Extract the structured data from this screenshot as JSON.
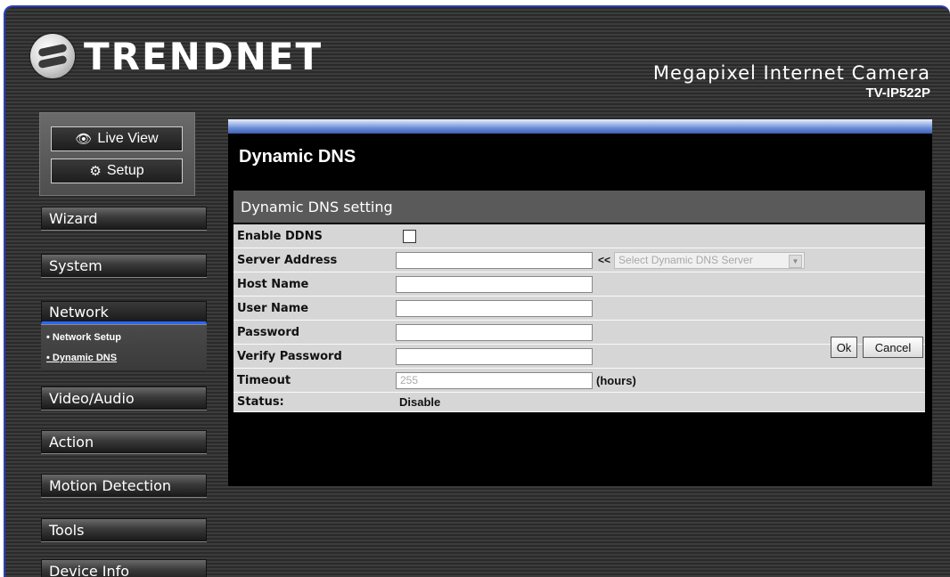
{
  "brand": {
    "logo_text": "TRENDNET",
    "product_name": "Megapixel Internet Camera",
    "model": "TV-IP522P"
  },
  "view_buttons": {
    "live_view": "Live View",
    "setup": "Setup"
  },
  "nav": {
    "wizard": "Wizard",
    "system": "System",
    "network": "Network",
    "network_sub": [
      "Network Setup",
      "Dynamic DNS"
    ],
    "video_audio": "Video/Audio",
    "action": "Action",
    "motion_detection": "Motion Detection",
    "tools": "Tools",
    "device_info": "Device Info"
  },
  "page": {
    "title": "Dynamic DNS",
    "section": "Dynamic DNS setting"
  },
  "form": {
    "enable_ddns_label": "Enable DDNS",
    "enable_ddns_checked": false,
    "server_address_label": "Server Address",
    "server_address_value": "",
    "server_select_arrows": "<<",
    "server_select_value": "Select Dynamic DNS Server",
    "host_name_label": "Host Name",
    "user_name_label": "User Name",
    "password_label": "Password",
    "verify_password_label": "Verify Password",
    "timeout_label": "Timeout",
    "timeout_value": "255",
    "timeout_unit": "(hours)",
    "status_label": "Status:",
    "status_value": "Disable"
  },
  "buttons": {
    "ok": "Ok",
    "cancel": "Cancel"
  },
  "colors": {
    "accent_blue": "#2a66ff",
    "header_bar": "#6d8fd8",
    "row_bg": "#d6d6d6"
  }
}
